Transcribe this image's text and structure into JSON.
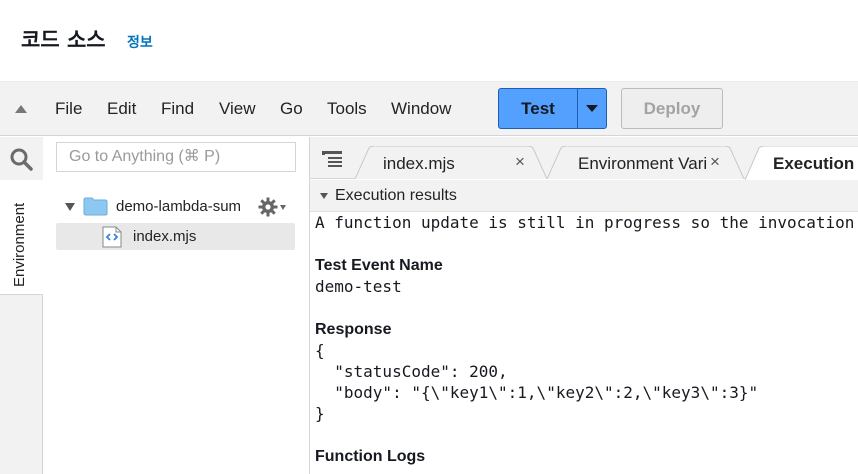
{
  "header": {
    "title": "코드 소스",
    "info_link": "정보"
  },
  "menubar": {
    "items": [
      "File",
      "Edit",
      "Find",
      "View",
      "Go",
      "Tools",
      "Window"
    ],
    "test_label": "Test",
    "deploy_label": "Deploy"
  },
  "sidebar": {
    "environment_label": "Environment",
    "search_placeholder": "Go to Anything (⌘ P)",
    "folder_name": "demo-lambda-sum",
    "file_name": "index.mjs"
  },
  "tabs": [
    {
      "label": "index.mjs",
      "close": "×"
    },
    {
      "label": "Environment Vari",
      "close": "×"
    },
    {
      "label": "Execution r"
    }
  ],
  "results": {
    "header_label": "Execution results",
    "notice": "A function update is still in progress so the invocation",
    "test_event_title": "Test Event Name",
    "test_event_value": "demo-test",
    "response_title": "Response",
    "response_lines": [
      "{",
      "  \"statusCode\": 200,",
      "  \"body\": \"{\\\"key1\\\":1,\\\"key2\\\":2,\\\"key3\\\":3}\"",
      "}"
    ],
    "logs_title": "Function Logs"
  },
  "colors": {
    "accent": "#54a0ff",
    "link": "#0073bb",
    "folder": "#8cc8ef"
  }
}
